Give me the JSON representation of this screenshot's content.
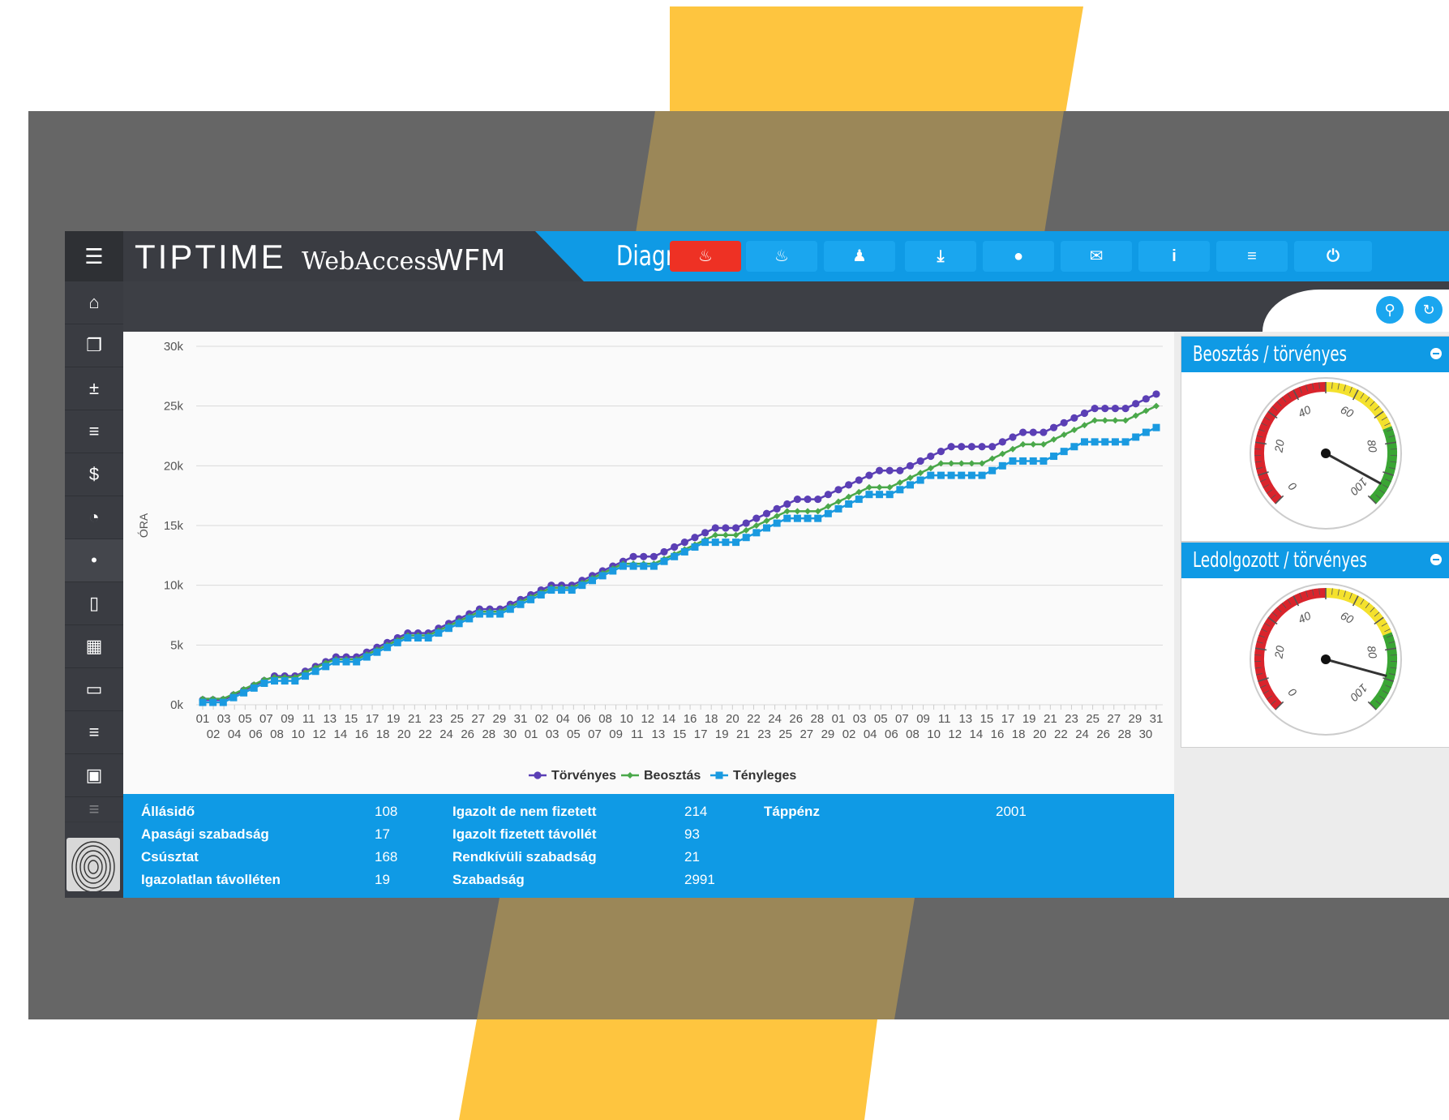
{
  "header": {
    "logo_tip": "TIPTIME",
    "logo_web": "WebAccess",
    "logo_wfm": "WFM",
    "title": "Diagramok",
    "buttons": [
      {
        "icon": "fire-icon",
        "active": true
      },
      {
        "icon": "flame-icon",
        "active": false
      },
      {
        "icon": "users-icon",
        "active": false
      },
      {
        "icon": "download-icon",
        "active": false
      },
      {
        "icon": "user-icon",
        "active": false
      },
      {
        "icon": "chat-icon",
        "active": false
      },
      {
        "icon": "info-icon",
        "active": false
      },
      {
        "icon": "database-settings-icon",
        "active": false
      },
      {
        "icon": "power-icon",
        "active": false
      }
    ]
  },
  "sidebar": {
    "items": [
      "home-icon",
      "copy-icon",
      "plus-minus-icon",
      "layers-icon",
      "dollar-icon",
      "pie-chart-icon",
      "dot-icon",
      "document-icon",
      "calendar-icon",
      "folder-icon",
      "stack-icon",
      "badge-icon",
      "stack-faded-icon"
    ]
  },
  "toolbar": {
    "buttons": [
      "search-icon",
      "refresh-icon"
    ]
  },
  "chart_data": {
    "type": "line",
    "ylabel": "ÓRA",
    "ylim": [
      0,
      30000
    ],
    "yticks": [
      "0k",
      "5k",
      "10k",
      "15k",
      "20k",
      "25k",
      "30k"
    ],
    "x_top_labels": [
      "01",
      "03",
      "05",
      "07",
      "09",
      "11",
      "13",
      "15",
      "17",
      "19",
      "21",
      "23",
      "25",
      "27",
      "29",
      "31",
      "02",
      "04",
      "06",
      "08",
      "10",
      "12",
      "14",
      "16",
      "18",
      "20",
      "22",
      "24",
      "26",
      "28",
      "01",
      "03",
      "05",
      "07",
      "09",
      "11",
      "13",
      "15",
      "17",
      "19",
      "21",
      "23",
      "25",
      "27",
      "29",
      "31"
    ],
    "x_bottom_labels": [
      "02",
      "04",
      "06",
      "08",
      "10",
      "12",
      "14",
      "16",
      "18",
      "20",
      "22",
      "24",
      "26",
      "28",
      "30",
      "01",
      "03",
      "05",
      "07",
      "09",
      "11",
      "13",
      "15",
      "17",
      "19",
      "21",
      "23",
      "25",
      "27",
      "29",
      "02",
      "04",
      "06",
      "08",
      "10",
      "12",
      "14",
      "16",
      "18",
      "20",
      "22",
      "24",
      "26",
      "28",
      "30"
    ],
    "series": [
      {
        "name": "Törvényes",
        "color": "#5b3fb5",
        "marker": "circle",
        "values": [
          400,
          400,
          400,
          800,
          1200,
          1600,
          2000,
          2400,
          2400,
          2400,
          2800,
          3200,
          3600,
          4000,
          4000,
          4000,
          4400,
          4800,
          5200,
          5600,
          6000,
          6000,
          6000,
          6400,
          6800,
          7200,
          7600,
          8000,
          8000,
          8000,
          8400,
          8800,
          9200,
          9600,
          10000,
          10000,
          10000,
          10400,
          10800,
          11200,
          11600,
          12000,
          12400,
          12400,
          12400,
          12800,
          13200,
          13600,
          14000,
          14400,
          14800,
          14800,
          14800,
          15200,
          15600,
          16000,
          16400,
          16800,
          17200,
          17200,
          17200,
          17600,
          18000,
          18400,
          18800,
          19200,
          19600,
          19600,
          19600,
          20000,
          20400,
          20800,
          21200,
          21600,
          21600,
          21600,
          21600,
          21600,
          22000,
          22400,
          22800,
          22800,
          22800,
          23200,
          23600,
          24000,
          24400,
          24800,
          24800,
          24800,
          24800,
          25200,
          25600,
          26000
        ]
      },
      {
        "name": "Beosztás",
        "color": "#4aa84a",
        "marker": "diamond",
        "values": [
          500,
          500,
          500,
          900,
          1300,
          1700,
          2100,
          2300,
          2300,
          2300,
          2700,
          3100,
          3500,
          3800,
          3800,
          3800,
          4200,
          4600,
          5000,
          5400,
          5800,
          5800,
          5800,
          6200,
          6600,
          7000,
          7400,
          7800,
          7800,
          7800,
          8200,
          8600,
          9000,
          9400,
          9800,
          9800,
          9800,
          10200,
          10600,
          11000,
          11400,
          11800,
          11800,
          11800,
          11800,
          12200,
          12600,
          13000,
          13400,
          13800,
          14200,
          14200,
          14200,
          14600,
          15000,
          15400,
          15800,
          16200,
          16200,
          16200,
          16200,
          16600,
          17000,
          17400,
          17800,
          18200,
          18200,
          18200,
          18600,
          19000,
          19400,
          19800,
          20200,
          20200,
          20200,
          20200,
          20200,
          20600,
          21000,
          21400,
          21800,
          21800,
          21800,
          22200,
          22600,
          23000,
          23400,
          23800,
          23800,
          23800,
          23800,
          24200,
          24600,
          25000
        ]
      },
      {
        "name": "Tényleges",
        "color": "#1a9ae0",
        "marker": "square",
        "values": [
          200,
          200,
          200,
          600,
          1000,
          1400,
          1800,
          2000,
          2000,
          2000,
          2400,
          2800,
          3200,
          3600,
          3600,
          3600,
          4000,
          4400,
          4800,
          5200,
          5600,
          5600,
          5600,
          6000,
          6400,
          6800,
          7200,
          7600,
          7600,
          7600,
          8000,
          8400,
          8800,
          9200,
          9600,
          9600,
          9600,
          10000,
          10400,
          10800,
          11200,
          11600,
          11600,
          11600,
          11600,
          12000,
          12400,
          12800,
          13200,
          13600,
          13600,
          13600,
          13600,
          14000,
          14400,
          14800,
          15200,
          15600,
          15600,
          15600,
          15600,
          16000,
          16400,
          16800,
          17200,
          17600,
          17600,
          17600,
          18000,
          18400,
          18800,
          19200,
          19200,
          19200,
          19200,
          19200,
          19200,
          19600,
          20000,
          20400,
          20400,
          20400,
          20400,
          20800,
          21200,
          21600,
          22000,
          22000,
          22000,
          22000,
          22000,
          22400,
          22800,
          23200
        ]
      }
    ]
  },
  "stats": {
    "col1": [
      {
        "label": "Állásidő",
        "value": "108"
      },
      {
        "label": "Apasági szabadság",
        "value": "17"
      },
      {
        "label": "Csúsztat",
        "value": "168"
      },
      {
        "label": "Igazolatlan távolléten",
        "value": "19"
      }
    ],
    "col2": [
      {
        "label": "Igazolt de nem fizetett",
        "value": "214"
      },
      {
        "label": "Igazolt fizetett távollét",
        "value": "93"
      },
      {
        "label": "Rendkívüli szabadság",
        "value": "21"
      },
      {
        "label": "Szabadság",
        "value": "2991"
      }
    ],
    "col3": [
      {
        "label": "Táppénz",
        "value": "2001"
      }
    ]
  },
  "gauges": [
    {
      "title": "Beosztás / törvényes",
      "value": 94,
      "ticks": [
        "0",
        "20",
        "40",
        "60",
        "80",
        "100"
      ]
    },
    {
      "title": "Ledolgozott / törvényes",
      "value": 89,
      "ticks": [
        "0",
        "20",
        "40",
        "60",
        "80",
        "100"
      ]
    }
  ],
  "colors": {
    "accent": "#0f9ae5",
    "danger": "#ee3124",
    "sidebar": "#3a3c42",
    "stripe": "#fec53f"
  }
}
